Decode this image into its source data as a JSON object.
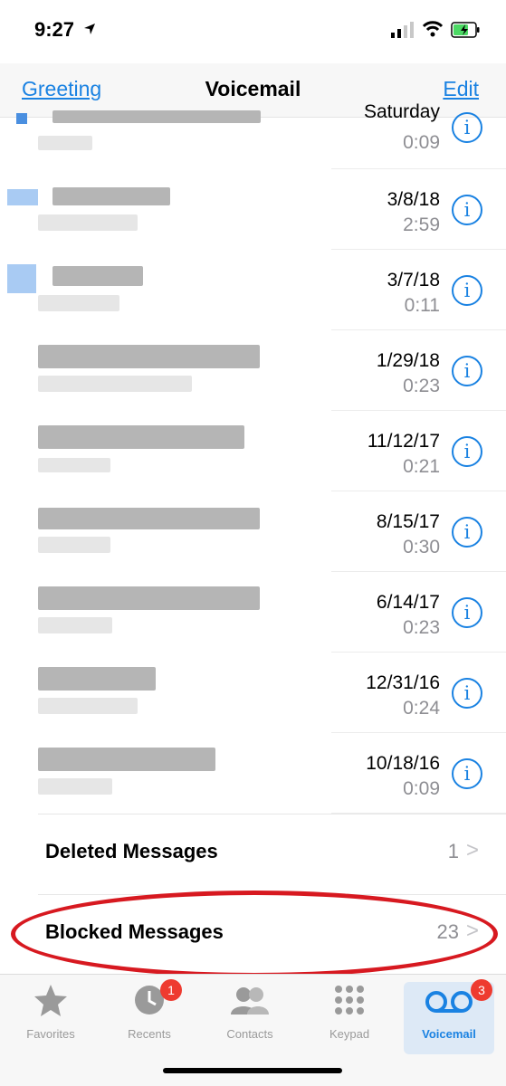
{
  "status_bar": {
    "time": "9:27",
    "icons": [
      "location-arrow-icon",
      "cellular-signal-icon",
      "wifi-icon",
      "battery-charging-icon"
    ]
  },
  "nav": {
    "left": "Greeting",
    "title": "Voicemail",
    "right": "Edit"
  },
  "voicemails": [
    {
      "date": "Saturday",
      "duration": "0:09",
      "unread": true
    },
    {
      "date": "3/8/18",
      "duration": "2:59",
      "unread": true
    },
    {
      "date": "3/7/18",
      "duration": "0:11",
      "unread": true
    },
    {
      "date": "1/29/18",
      "duration": "0:23",
      "unread": false
    },
    {
      "date": "11/12/17",
      "duration": "0:21",
      "unread": false
    },
    {
      "date": "8/15/17",
      "duration": "0:30",
      "unread": false
    },
    {
      "date": "6/14/17",
      "duration": "0:23",
      "unread": false
    },
    {
      "date": "12/31/16",
      "duration": "0:24",
      "unread": false
    },
    {
      "date": "10/18/16",
      "duration": "0:09",
      "unread": false
    }
  ],
  "info_glyph": "i",
  "sections": {
    "deleted": {
      "label": "Deleted Messages",
      "count": "1",
      "chevron": ">"
    },
    "blocked": {
      "label": "Blocked Messages",
      "count": "23",
      "chevron": ">"
    }
  },
  "tabs": {
    "favorites": {
      "label": "Favorites",
      "icon": "star-icon"
    },
    "recents": {
      "label": "Recents",
      "icon": "clock-icon",
      "badge": "1"
    },
    "contacts": {
      "label": "Contacts",
      "icon": "contacts-icon"
    },
    "keypad": {
      "label": "Keypad",
      "icon": "keypad-icon"
    },
    "voicemail": {
      "label": "Voicemail",
      "icon": "voicemail-icon",
      "badge": "3",
      "active": true
    }
  },
  "colors": {
    "accent": "#1a82e2",
    "badge": "#ee3b30",
    "highlight": "#d71920",
    "secondary_text": "#8e8e93"
  }
}
